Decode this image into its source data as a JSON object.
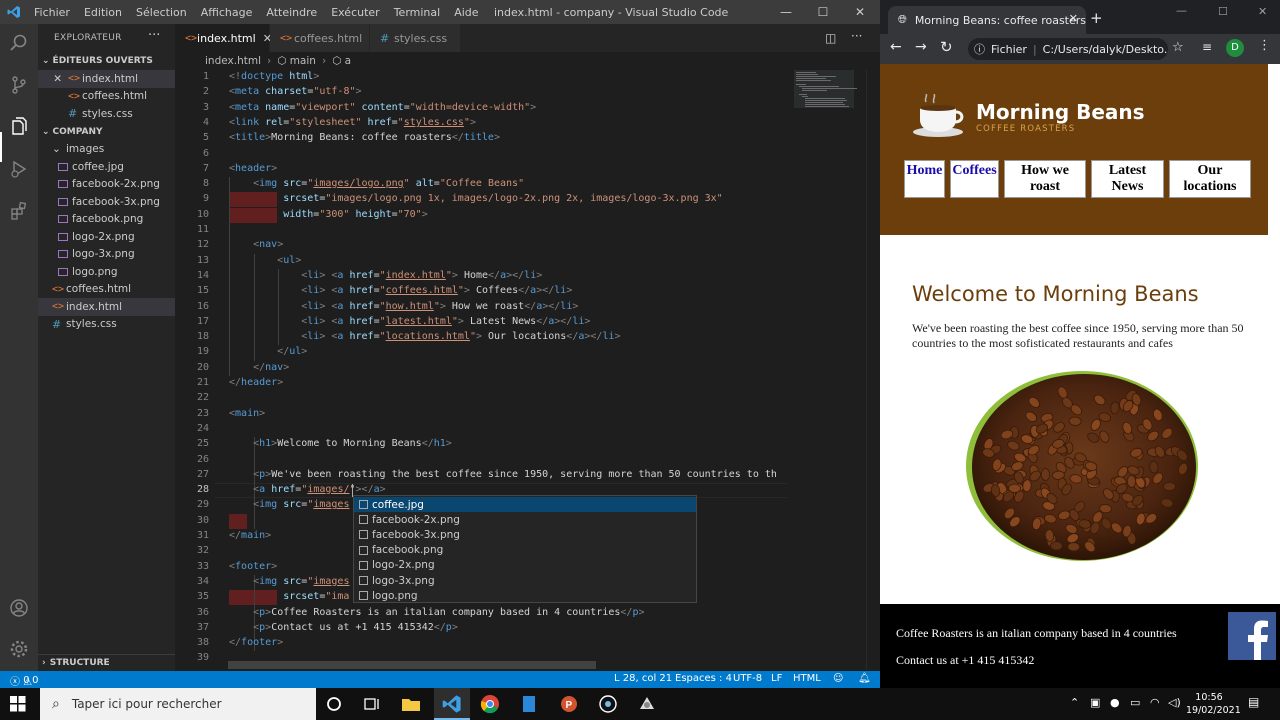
{
  "vscode": {
    "menu": [
      "Fichier",
      "Edition",
      "Sélection",
      "Affichage",
      "Atteindre",
      "Exécuter",
      "Terminal",
      "Aide"
    ],
    "window_title": "index.html - company - Visual Studio Code",
    "explorer": {
      "header": "EXPLORATEUR",
      "open_editors_title": "ÉDITEURS OUVERTS",
      "open_editors": [
        "index.html",
        "coffees.html",
        "styles.css"
      ],
      "folder_title": "COMPANY",
      "images_folder": "images",
      "images": [
        "coffee.jpg",
        "facebook-2x.png",
        "facebook-3x.png",
        "facebook.png",
        "logo-2x.png",
        "logo-3x.png",
        "logo.png"
      ],
      "root_files": [
        "coffees.html",
        "index.html",
        "styles.css"
      ],
      "structure": "STRUCTURE"
    },
    "tabs": [
      "index.html",
      "coffees.html",
      "styles.css"
    ],
    "breadcrumb": [
      "index.html",
      "main",
      "a"
    ],
    "code_lines": [
      {
        "n": "1",
        "html": "<span class='t'>&lt;!</span><span class='tn'>doctype</span> <span class='an'>html</span><span class='t'>&gt;</span>"
      },
      {
        "n": "2",
        "html": "<span class='t'>&lt;</span><span class='tn'>meta</span> <span class='an'>charset</span>=<span class='av'>\"utf-8\"</span><span class='t'>&gt;</span>"
      },
      {
        "n": "3",
        "html": "<span class='t'>&lt;</span><span class='tn'>meta</span> <span class='an'>name</span>=<span class='av'>\"viewport\"</span> <span class='an'>content</span>=<span class='av'>\"width=device-width\"</span><span class='t'>&gt;</span>"
      },
      {
        "n": "4",
        "html": "<span class='t'>&lt;</span><span class='tn'>link</span> <span class='an'>rel</span>=<span class='av'>\"stylesheet\"</span> <span class='an'>href</span>=<span class='av'>\"<span class='u'>styles.css</span>\"</span><span class='t'>&gt;</span>"
      },
      {
        "n": "5",
        "html": "<span class='t'>&lt;</span><span class='tn'>title</span><span class='t'>&gt;</span>Morning Beans: coffee roasters<span class='t'>&lt;/</span><span class='tn'>title</span><span class='t'>&gt;</span>"
      },
      {
        "n": "6",
        "html": ""
      },
      {
        "n": "7",
        "html": "<span class='t'>&lt;</span><span class='tn'>header</span><span class='t'>&gt;</span>"
      },
      {
        "n": "8",
        "html": "    <span class='t'>&lt;</span><span class='tn'>img</span> <span class='an'>src</span>=<span class='av'>\"<span class='u'>images/logo.png</span>\"</span> <span class='an'>alt</span>=<span class='av'>\"Coffee Beans\"</span>"
      },
      {
        "n": "9",
        "html": "         <span class='an'>srcset</span>=<span class='av'>\"images/logo.png 1x, images/logo-2x.png 2x, images/logo-3x.png 3x\"</span>"
      },
      {
        "n": "10",
        "html": "         <span class='an'>width</span>=<span class='av'>\"300\"</span> <span class='an'>height</span>=<span class='av'>\"70\"</span><span class='t'>&gt;</span>"
      },
      {
        "n": "11",
        "html": ""
      },
      {
        "n": "12",
        "html": "    <span class='t'>&lt;</span><span class='tn'>nav</span><span class='t'>&gt;</span>"
      },
      {
        "n": "13",
        "html": "        <span class='t'>&lt;</span><span class='tn'>ul</span><span class='t'>&gt;</span>"
      },
      {
        "n": "14",
        "html": "            <span class='t'>&lt;</span><span class='tn'>li</span><span class='t'>&gt;</span> <span class='t'>&lt;</span><span class='tn'>a</span> <span class='an'>href</span>=<span class='av'>\"<span class='u'>index.html</span>\"</span><span class='t'>&gt;</span> Home<span class='t'>&lt;/</span><span class='tn'>a</span><span class='t'>&gt;&lt;/</span><span class='tn'>li</span><span class='t'>&gt;</span>"
      },
      {
        "n": "15",
        "html": "            <span class='t'>&lt;</span><span class='tn'>li</span><span class='t'>&gt;</span> <span class='t'>&lt;</span><span class='tn'>a</span> <span class='an'>href</span>=<span class='av'>\"<span class='u'>coffees.html</span>\"</span><span class='t'>&gt;</span> Coffees<span class='t'>&lt;/</span><span class='tn'>a</span><span class='t'>&gt;&lt;/</span><span class='tn'>li</span><span class='t'>&gt;</span>"
      },
      {
        "n": "16",
        "html": "            <span class='t'>&lt;</span><span class='tn'>li</span><span class='t'>&gt;</span> <span class='t'>&lt;</span><span class='tn'>a</span> <span class='an'>href</span>=<span class='av'>\"<span class='u'>how.html</span>\"</span><span class='t'>&gt;</span> How we roast<span class='t'>&lt;/</span><span class='tn'>a</span><span class='t'>&gt;&lt;/</span><span class='tn'>li</span><span class='t'>&gt;</span>"
      },
      {
        "n": "17",
        "html": "            <span class='t'>&lt;</span><span class='tn'>li</span><span class='t'>&gt;</span> <span class='t'>&lt;</span><span class='tn'>a</span> <span class='an'>href</span>=<span class='av'>\"<span class='u'>latest.html</span>\"</span><span class='t'>&gt;</span> Latest News<span class='t'>&lt;/</span><span class='tn'>a</span><span class='t'>&gt;&lt;/</span><span class='tn'>li</span><span class='t'>&gt;</span>"
      },
      {
        "n": "18",
        "html": "            <span class='t'>&lt;</span><span class='tn'>li</span><span class='t'>&gt;</span> <span class='t'>&lt;</span><span class='tn'>a</span> <span class='an'>href</span>=<span class='av'>\"<span class='u'>locations.html</span>\"</span><span class='t'>&gt;</span> Our locations<span class='t'>&lt;/</span><span class='tn'>a</span><span class='t'>&gt;&lt;/</span><span class='tn'>li</span><span class='t'>&gt;</span>"
      },
      {
        "n": "19",
        "html": "        <span class='t'>&lt;/</span><span class='tn'>ul</span><span class='t'>&gt;</span>"
      },
      {
        "n": "20",
        "html": "    <span class='t'>&lt;/</span><span class='tn'>nav</span><span class='t'>&gt;</span>"
      },
      {
        "n": "21",
        "html": "<span class='t'>&lt;/</span><span class='tn'>header</span><span class='t'>&gt;</span>"
      },
      {
        "n": "22",
        "html": ""
      },
      {
        "n": "23",
        "html": "<span class='t'>&lt;</span><span class='tn'>main</span><span class='t'>&gt;</span>"
      },
      {
        "n": "24",
        "html": ""
      },
      {
        "n": "25",
        "html": "    <span class='t'>&lt;</span><span class='tn'>h1</span><span class='t'>&gt;</span>Welcome to Morning Beans<span class='t'>&lt;/</span><span class='tn'>h1</span><span class='t'>&gt;</span>"
      },
      {
        "n": "26",
        "html": ""
      },
      {
        "n": "27",
        "html": "    <span class='t'>&lt;</span><span class='tn'>p</span><span class='t'>&gt;</span>We've been roasting the best coffee since 1950, serving more than 50 countries to th"
      },
      {
        "n": "28",
        "html": "    <span class='t'>&lt;</span><span class='tn'>a</span> <span class='an'>href</span>=<span class='av'>\"<span class='u'>images/</span>\"</span><span class='t'>&gt;&lt;/</span><span class='tn'>a</span><span class='t'>&gt;</span>"
      },
      {
        "n": "29",
        "html": "    <span class='t'>&lt;</span><span class='tn'>img</span> <span class='an'>src</span>=<span class='av'>\"<span class='u'>images</span></span>"
      },
      {
        "n": "30",
        "html": ""
      },
      {
        "n": "31",
        "html": "<span class='t'>&lt;/</span><span class='tn'>main</span><span class='t'>&gt;</span>"
      },
      {
        "n": "32",
        "html": ""
      },
      {
        "n": "33",
        "html": "<span class='t'>&lt;</span><span class='tn'>footer</span><span class='t'>&gt;</span>"
      },
      {
        "n": "34",
        "html": "    <span class='t'>&lt;</span><span class='tn'>img</span> <span class='an'>src</span>=<span class='av'>\"<span class='u'>images</span></span>                                     <span class='av'>Page\"</span> <span class='an'>id</span>=<span class='av'>\"faceb</span>"
      },
      {
        "n": "35",
        "html": "         <span class='an'>srcset</span>=<span class='av'>\"ima</span>                                      <span class='av'>acebook-3x.png</span>"
      },
      {
        "n": "36",
        "html": "    <span class='t'>&lt;</span><span class='tn'>p</span><span class='t'>&gt;</span>Coffee Roasters is an italian company based in 4 countries<span class='t'>&lt;/</span><span class='tn'>p</span><span class='t'>&gt;</span>"
      },
      {
        "n": "37",
        "html": "    <span class='t'>&lt;</span><span class='tn'>p</span><span class='t'>&gt;</span>Contact us at +1 415 415342<span class='t'>&lt;/</span><span class='tn'>p</span><span class='t'>&gt;</span>"
      },
      {
        "n": "38",
        "html": "<span class='t'>&lt;/</span><span class='tn'>footer</span><span class='t'>&gt;</span>"
      },
      {
        "n": "39",
        "html": ""
      }
    ],
    "autocomplete": [
      "coffee.jpg",
      "facebook-2x.png",
      "facebook-3x.png",
      "facebook.png",
      "logo-2x.png",
      "logo-3x.png",
      "logo.png"
    ],
    "status": {
      "errors": "0",
      "warnings": "0",
      "position": "L 28, col 21",
      "spaces": "Espaces : 4",
      "encoding": "UTF-8",
      "eol": "LF",
      "language": "HTML"
    }
  },
  "browser": {
    "tab_title": "Morning Beans: coffee roasters",
    "address_label": "Fichier",
    "address": "C:/Users/dalyk/Deskto...",
    "profile_initial": "D",
    "page": {
      "brand": "Morning Beans",
      "tagline": "COFFEE ROASTERS",
      "nav": [
        "Home",
        "Coffees",
        "How we roast",
        "Latest News",
        "Our locations"
      ],
      "h1": "Welcome to Morning Beans",
      "intro": "We've been roasting the best coffee since 1950, serving more than 50 countries to the most sofisticated restaurants and cafes",
      "footer_line1": "Coffee Roasters is an italian company based in 4 countries",
      "footer_line2": "Contact us at +1 415 415342"
    }
  },
  "taskbar": {
    "search_placeholder": "Taper ici pour rechercher",
    "time": "10:56",
    "date": "19/02/2021"
  },
  "colors": {
    "vscode_accent": "#007acc",
    "header_brown": "#6b3e0c",
    "facebook_blue": "#3b5998"
  }
}
